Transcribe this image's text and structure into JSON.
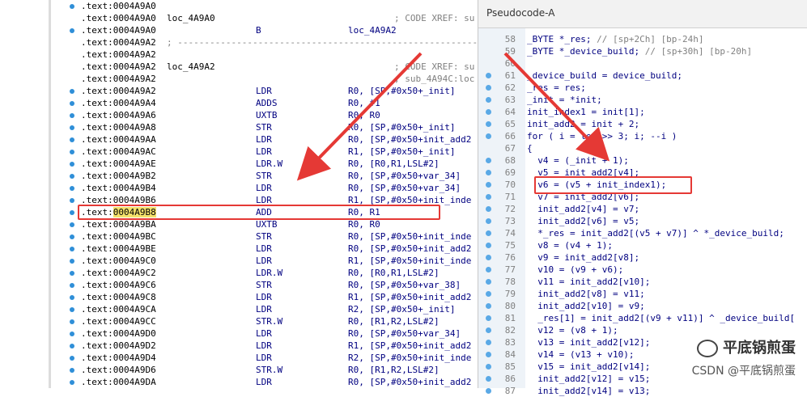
{
  "ida": {
    "lines": [
      {
        "addr": ".text:0004A9A0",
        "label": "",
        "mnemonic": "",
        "operands": "",
        "comment": "",
        "dot": true
      },
      {
        "addr": ".text:0004A9A0",
        "label": "loc_4A9A0",
        "mnemonic": "",
        "operands": "",
        "comment": "; CODE XREF: su",
        "dot": false
      },
      {
        "addr": ".text:0004A9A0",
        "label": "",
        "mnemonic": "B",
        "operands": "loc_4A9A2",
        "comment": "",
        "dot": true
      },
      {
        "addr": ".text:0004A9A2",
        "label": "; ---------------------------------------------------------------",
        "mnemonic": "",
        "operands": "",
        "comment": "",
        "dot": false,
        "separator": true
      },
      {
        "addr": ".text:0004A9A2",
        "label": "",
        "mnemonic": "",
        "operands": "",
        "comment": "",
        "dot": false
      },
      {
        "addr": ".text:0004A9A2",
        "label": "loc_4A9A2",
        "mnemonic": "",
        "operands": "",
        "comment": "; CODE XREF: su",
        "dot": false
      },
      {
        "addr": ".text:0004A9A2",
        "label": "",
        "mnemonic": "",
        "operands": "",
        "comment": "; sub_4A94C:loc",
        "dot": false
      },
      {
        "addr": ".text:0004A9A2",
        "label": "",
        "mnemonic": "LDR",
        "operands": "R0, [SP,#0x50+_init]",
        "comment": "",
        "dot": true
      },
      {
        "addr": ".text:0004A9A4",
        "label": "",
        "mnemonic": "ADDS",
        "operands": "R0, #1",
        "comment": "",
        "dot": true
      },
      {
        "addr": ".text:0004A9A6",
        "label": "",
        "mnemonic": "UXTB",
        "operands": "R0, R0",
        "comment": "",
        "dot": true
      },
      {
        "addr": ".text:0004A9A8",
        "label": "",
        "mnemonic": "STR",
        "operands": "R0, [SP,#0x50+_init]",
        "comment": "",
        "dot": true
      },
      {
        "addr": ".text:0004A9AA",
        "label": "",
        "mnemonic": "LDR",
        "operands": "R0, [SP,#0x50+init_add2",
        "comment": "",
        "dot": true
      },
      {
        "addr": ".text:0004A9AC",
        "label": "",
        "mnemonic": "LDR",
        "operands": "R1, [SP,#0x50+_init]",
        "comment": "",
        "dot": true
      },
      {
        "addr": ".text:0004A9AE",
        "label": "",
        "mnemonic": "LDR.W",
        "operands": "R0, [R0,R1,LSL#2]",
        "comment": "",
        "dot": true
      },
      {
        "addr": ".text:0004A9B2",
        "label": "",
        "mnemonic": "STR",
        "operands": "R0, [SP,#0x50+var_34]",
        "comment": "",
        "dot": true
      },
      {
        "addr": ".text:0004A9B4",
        "label": "",
        "mnemonic": "LDR",
        "operands": "R0, [SP,#0x50+var_34]",
        "comment": "",
        "dot": true
      },
      {
        "addr": ".text:0004A9B6",
        "label": "",
        "mnemonic": "LDR",
        "operands": "R1, [SP,#0x50+init_inde",
        "comment": "",
        "dot": true
      },
      {
        "addr": ".text:0004A9B8",
        "label": "",
        "mnemonic": "ADD",
        "operands": "R0, R1",
        "comment": "",
        "dot": true,
        "highlight": true
      },
      {
        "addr": ".text:0004A9BA",
        "label": "",
        "mnemonic": "UXTB",
        "operands": "R0, R0",
        "comment": "",
        "dot": true
      },
      {
        "addr": ".text:0004A9BC",
        "label": "",
        "mnemonic": "STR",
        "operands": "R0, [SP,#0x50+init_inde",
        "comment": "",
        "dot": true
      },
      {
        "addr": ".text:0004A9BE",
        "label": "",
        "mnemonic": "LDR",
        "operands": "R0, [SP,#0x50+init_add2",
        "comment": "",
        "dot": true
      },
      {
        "addr": ".text:0004A9C0",
        "label": "",
        "mnemonic": "LDR",
        "operands": "R1, [SP,#0x50+init_inde",
        "comment": "",
        "dot": true
      },
      {
        "addr": ".text:0004A9C2",
        "label": "",
        "mnemonic": "LDR.W",
        "operands": "R0, [R0,R1,LSL#2]",
        "comment": "",
        "dot": true
      },
      {
        "addr": ".text:0004A9C6",
        "label": "",
        "mnemonic": "STR",
        "operands": "R0, [SP,#0x50+var_38]",
        "comment": "",
        "dot": true
      },
      {
        "addr": ".text:0004A9C8",
        "label": "",
        "mnemonic": "LDR",
        "operands": "R1, [SP,#0x50+init_add2",
        "comment": "",
        "dot": true
      },
      {
        "addr": ".text:0004A9CA",
        "label": "",
        "mnemonic": "LDR",
        "operands": "R2, [SP,#0x50+_init]",
        "comment": "",
        "dot": true
      },
      {
        "addr": ".text:0004A9CC",
        "label": "",
        "mnemonic": "STR.W",
        "operands": "R0, [R1,R2,LSL#2]",
        "comment": "",
        "dot": true
      },
      {
        "addr": ".text:0004A9D0",
        "label": "",
        "mnemonic": "LDR",
        "operands": "R0, [SP,#0x50+var_34]",
        "comment": "",
        "dot": true
      },
      {
        "addr": ".text:0004A9D2",
        "label": "",
        "mnemonic": "LDR",
        "operands": "R1, [SP,#0x50+init_add2",
        "comment": "",
        "dot": true
      },
      {
        "addr": ".text:0004A9D4",
        "label": "",
        "mnemonic": "LDR",
        "operands": "R2, [SP,#0x50+init_inde",
        "comment": "",
        "dot": true
      },
      {
        "addr": ".text:0004A9D6",
        "label": "",
        "mnemonic": "STR.W",
        "operands": "R0, [R1,R2,LSL#2]",
        "comment": "",
        "dot": true
      },
      {
        "addr": ".text:0004A9DA",
        "label": "",
        "mnemonic": "LDR",
        "operands": "R0, [SP,#0x50+init_add2",
        "comment": "",
        "dot": true
      }
    ]
  },
  "pseudo": {
    "title": "Pseudocode-A",
    "lines": [
      {
        "num": "58",
        "code": "_BYTE *_res; ",
        "comment": "// [sp+2Ch] [bp-24h]",
        "dot": false
      },
      {
        "num": "59",
        "code": "_BYTE *_device_build; ",
        "comment": "// [sp+30h] [bp-20h]",
        "dot": false
      },
      {
        "num": "60",
        "code": "",
        "comment": "",
        "dot": false
      },
      {
        "num": "61",
        "code": "_device_build = device_build;",
        "comment": "",
        "dot": true
      },
      {
        "num": "62",
        "code": "_res = res;",
        "comment": "",
        "dot": true
      },
      {
        "num": "63",
        "code": "_init = *init;",
        "comment": "",
        "dot": true
      },
      {
        "num": "64",
        "code": "init_index1 = init[1];",
        "comment": "",
        "dot": true
      },
      {
        "num": "65",
        "code": "init_add2 = init + 2;",
        "comment": "",
        "dot": true
      },
      {
        "num": "66",
        "code": "for ( i = len >> 3; i; --i )",
        "comment": "",
        "dot": true
      },
      {
        "num": "67",
        "code": "{",
        "comment": "",
        "dot": false
      },
      {
        "num": "68",
        "code": "  v4 = (_init + 1);",
        "comment": "",
        "dot": true
      },
      {
        "num": "69",
        "code": "  v5 = init_add2[v4];",
        "comment": "",
        "dot": true
      },
      {
        "num": "70",
        "code": "  v6 = (v5 + init_index1);",
        "comment": "",
        "dot": true
      },
      {
        "num": "71",
        "code": "  v7 = init_add2[v6];",
        "comment": "",
        "dot": true
      },
      {
        "num": "72",
        "code": "  init_add2[v4] = v7;",
        "comment": "",
        "dot": true
      },
      {
        "num": "73",
        "code": "  init_add2[v6] = v5;",
        "comment": "",
        "dot": true
      },
      {
        "num": "74",
        "code": "  *_res = init_add2[(v5 + v7)] ^ *_device_build;",
        "comment": "",
        "dot": true
      },
      {
        "num": "75",
        "code": "  v8 = (v4 + 1);",
        "comment": "",
        "dot": true
      },
      {
        "num": "76",
        "code": "  v9 = init_add2[v8];",
        "comment": "",
        "dot": true
      },
      {
        "num": "77",
        "code": "  v10 = (v9 + v6);",
        "comment": "",
        "dot": true
      },
      {
        "num": "78",
        "code": "  v11 = init_add2[v10];",
        "comment": "",
        "dot": true
      },
      {
        "num": "79",
        "code": "  init_add2[v8] = v11;",
        "comment": "",
        "dot": true
      },
      {
        "num": "80",
        "code": "  init_add2[v10] = v9;",
        "comment": "",
        "dot": true
      },
      {
        "num": "81",
        "code": "  _res[1] = init_add2[(v9 + v11)] ^ _device_build[",
        "comment": "",
        "dot": true
      },
      {
        "num": "82",
        "code": "  v12 = (v8 + 1);",
        "comment": "",
        "dot": true
      },
      {
        "num": "83",
        "code": "  v13 = init_add2[v12];",
        "comment": "",
        "dot": true
      },
      {
        "num": "84",
        "code": "  v14 = (v13 + v10);",
        "comment": "",
        "dot": true
      },
      {
        "num": "85",
        "code": "  v15 = init_add2[v14];",
        "comment": "",
        "dot": true
      },
      {
        "num": "86",
        "code": "  init_add2[v12] = v15;",
        "comment": "",
        "dot": true
      },
      {
        "num": "87",
        "code": "  init_add2[v14] = v13;",
        "comment": "",
        "dot": true
      }
    ]
  },
  "watermark": {
    "line1": "平底锅煎蛋",
    "line2": "CSDN @平底锅煎蛋"
  },
  "colors": {
    "highlight_box": "#e53935",
    "arrow": "#e53935",
    "addr_highlight": "#f5e26b",
    "gutter_dot": "#2f8fd8"
  }
}
